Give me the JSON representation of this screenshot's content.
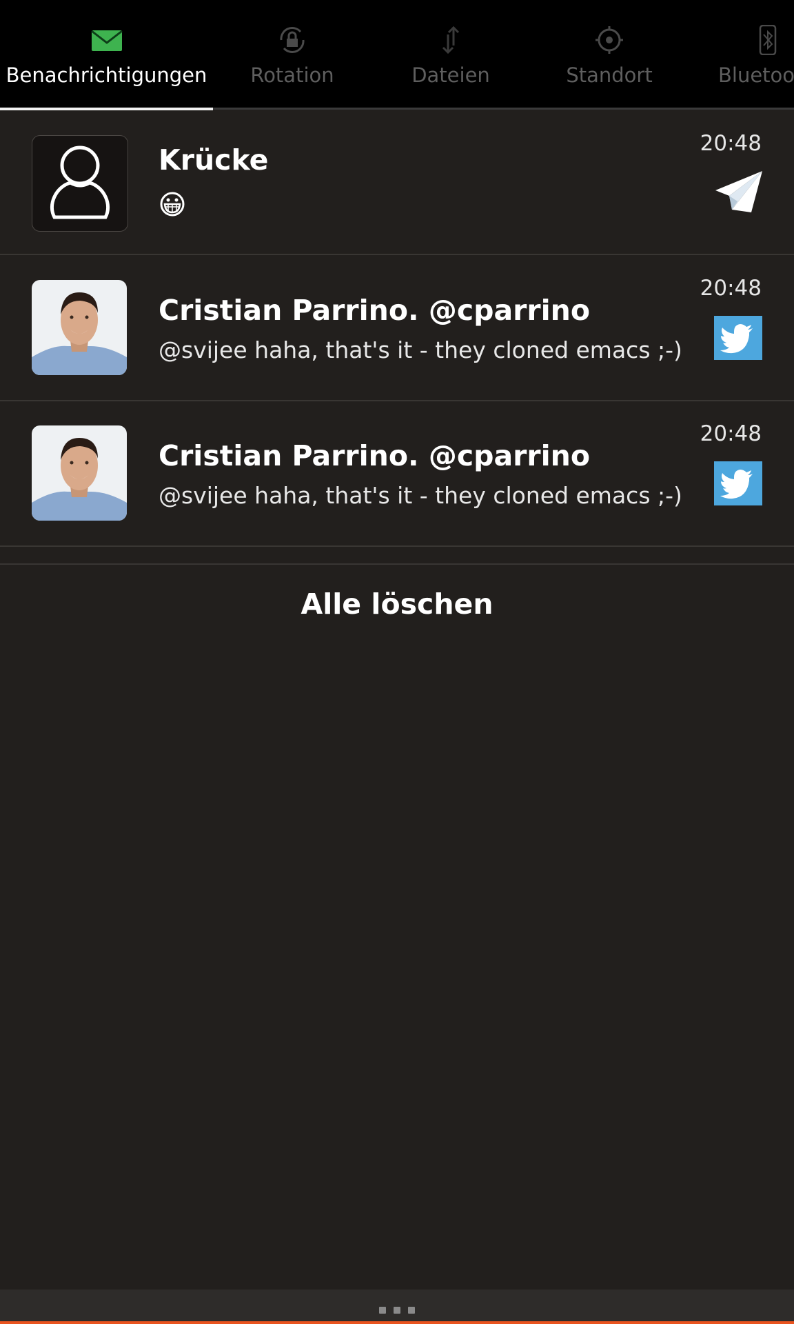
{
  "colors": {
    "background": "#221f1d",
    "tabbar": "#000000",
    "accent": "#e95420",
    "message_icon": "#3eb34f",
    "twitter": "#4da7de"
  },
  "tabs": [
    {
      "label": "Benachrichtigungen",
      "icon": "envelope-icon",
      "active": true
    },
    {
      "label": "Rotation",
      "icon": "rotation-lock-icon",
      "active": false
    },
    {
      "label": "Dateien",
      "icon": "transfer-arrows-icon",
      "active": false
    },
    {
      "label": "Standort",
      "icon": "location-crosshair-icon",
      "active": false
    },
    {
      "label": "Bluetoo",
      "icon": "bluetooth-icon",
      "active": false
    }
  ],
  "notifications": [
    {
      "title": "Krücke",
      "body": "",
      "time": "20:48",
      "app": "telegram-icon",
      "avatar": "generic-contact-avatar",
      "extra": "grinning-emoji"
    },
    {
      "title": "Cristian Parrino. @cparrino",
      "body": "@svijee haha, that's it - they cloned emacs ;-)",
      "time": "20:48",
      "app": "twitter-icon",
      "avatar": "photo-avatar"
    },
    {
      "title": "Cristian Parrino. @cparrino",
      "body": "@svijee haha, that's it - they cloned emacs ;-)",
      "time": "20:48",
      "app": "twitter-icon",
      "avatar": "photo-avatar"
    }
  ],
  "clear_all_label": "Alle löschen"
}
